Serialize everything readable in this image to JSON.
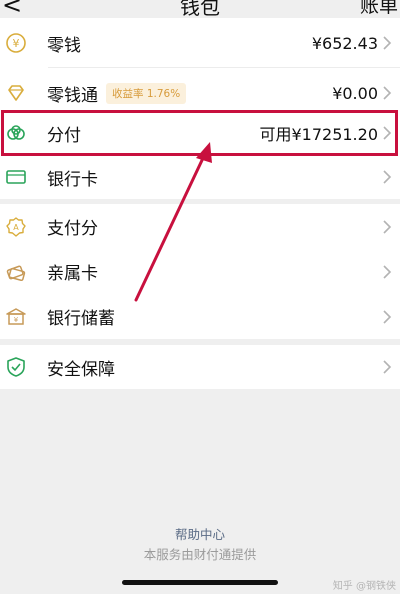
{
  "header": {
    "back_glyph": "<",
    "title": "钱包",
    "bill_label": "账单"
  },
  "wallet": {
    "change": {
      "label": "零钱",
      "value": "¥652.43",
      "icon": "coin-icon"
    },
    "lqt": {
      "label": "零钱通",
      "badge": "收益率 1.76%",
      "value": "¥0.00",
      "icon": "diamond-icon"
    },
    "fenfu": {
      "label": "分付",
      "value": "可用¥17251.20",
      "icon": "cloud-icon"
    },
    "bank_card": {
      "label": "银行卡",
      "icon": "card-icon"
    }
  },
  "services": {
    "zhifufen": {
      "label": "支付分",
      "icon": "badge-icon"
    },
    "family_card": {
      "label": "亲属卡",
      "icon": "family-card-icon"
    },
    "savings": {
      "label": "银行储蓄",
      "icon": "bank-icon"
    }
  },
  "security": {
    "label": "安全保障",
    "icon": "shield-icon"
  },
  "footer": {
    "help": "帮助中心",
    "note": "本服务由财付通提供"
  },
  "watermark": "知乎 @钢铁侠",
  "colors": {
    "highlight": "#c8103e",
    "gold": "#d9ad3c",
    "green": "#2aa45a",
    "background": "#efefef"
  }
}
